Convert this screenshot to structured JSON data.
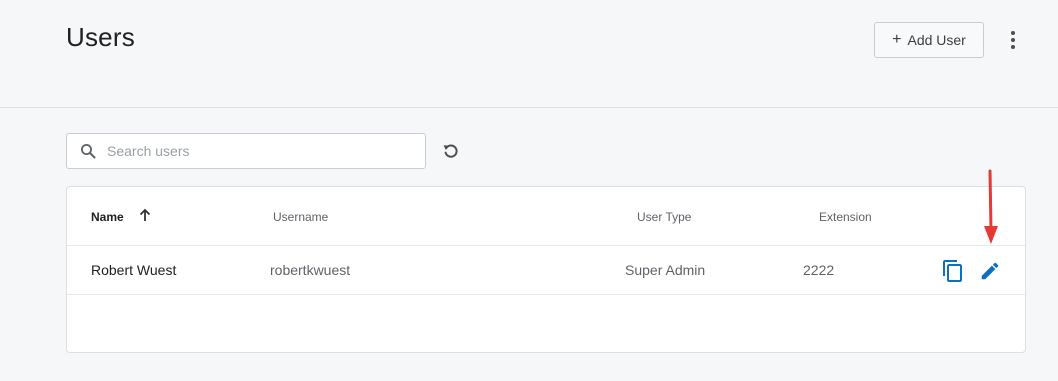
{
  "header": {
    "title": "Users",
    "add_user_label": "Add User",
    "add_user_icon": "plus-icon",
    "more_icon": "more-vertical-icon"
  },
  "search": {
    "placeholder": "Search users",
    "value": "",
    "icon": "search-icon",
    "refresh_icon": "refresh-icon"
  },
  "table": {
    "columns": {
      "name": "Name",
      "username": "Username",
      "user_type": "User Type",
      "extension": "Extension"
    },
    "sort": {
      "column": "Name",
      "direction": "ascending",
      "icon": "arrow-up-icon"
    },
    "rows": [
      {
        "name": "Robert Wuest",
        "username": "robertkwuest",
        "user_type": "Super Admin",
        "extension": "2222",
        "actions": [
          "copy-icon",
          "edit-icon"
        ]
      }
    ]
  },
  "colors": {
    "accent": "#0f6fbf",
    "annotation": "#e53935",
    "background": "#f5f7f9"
  }
}
